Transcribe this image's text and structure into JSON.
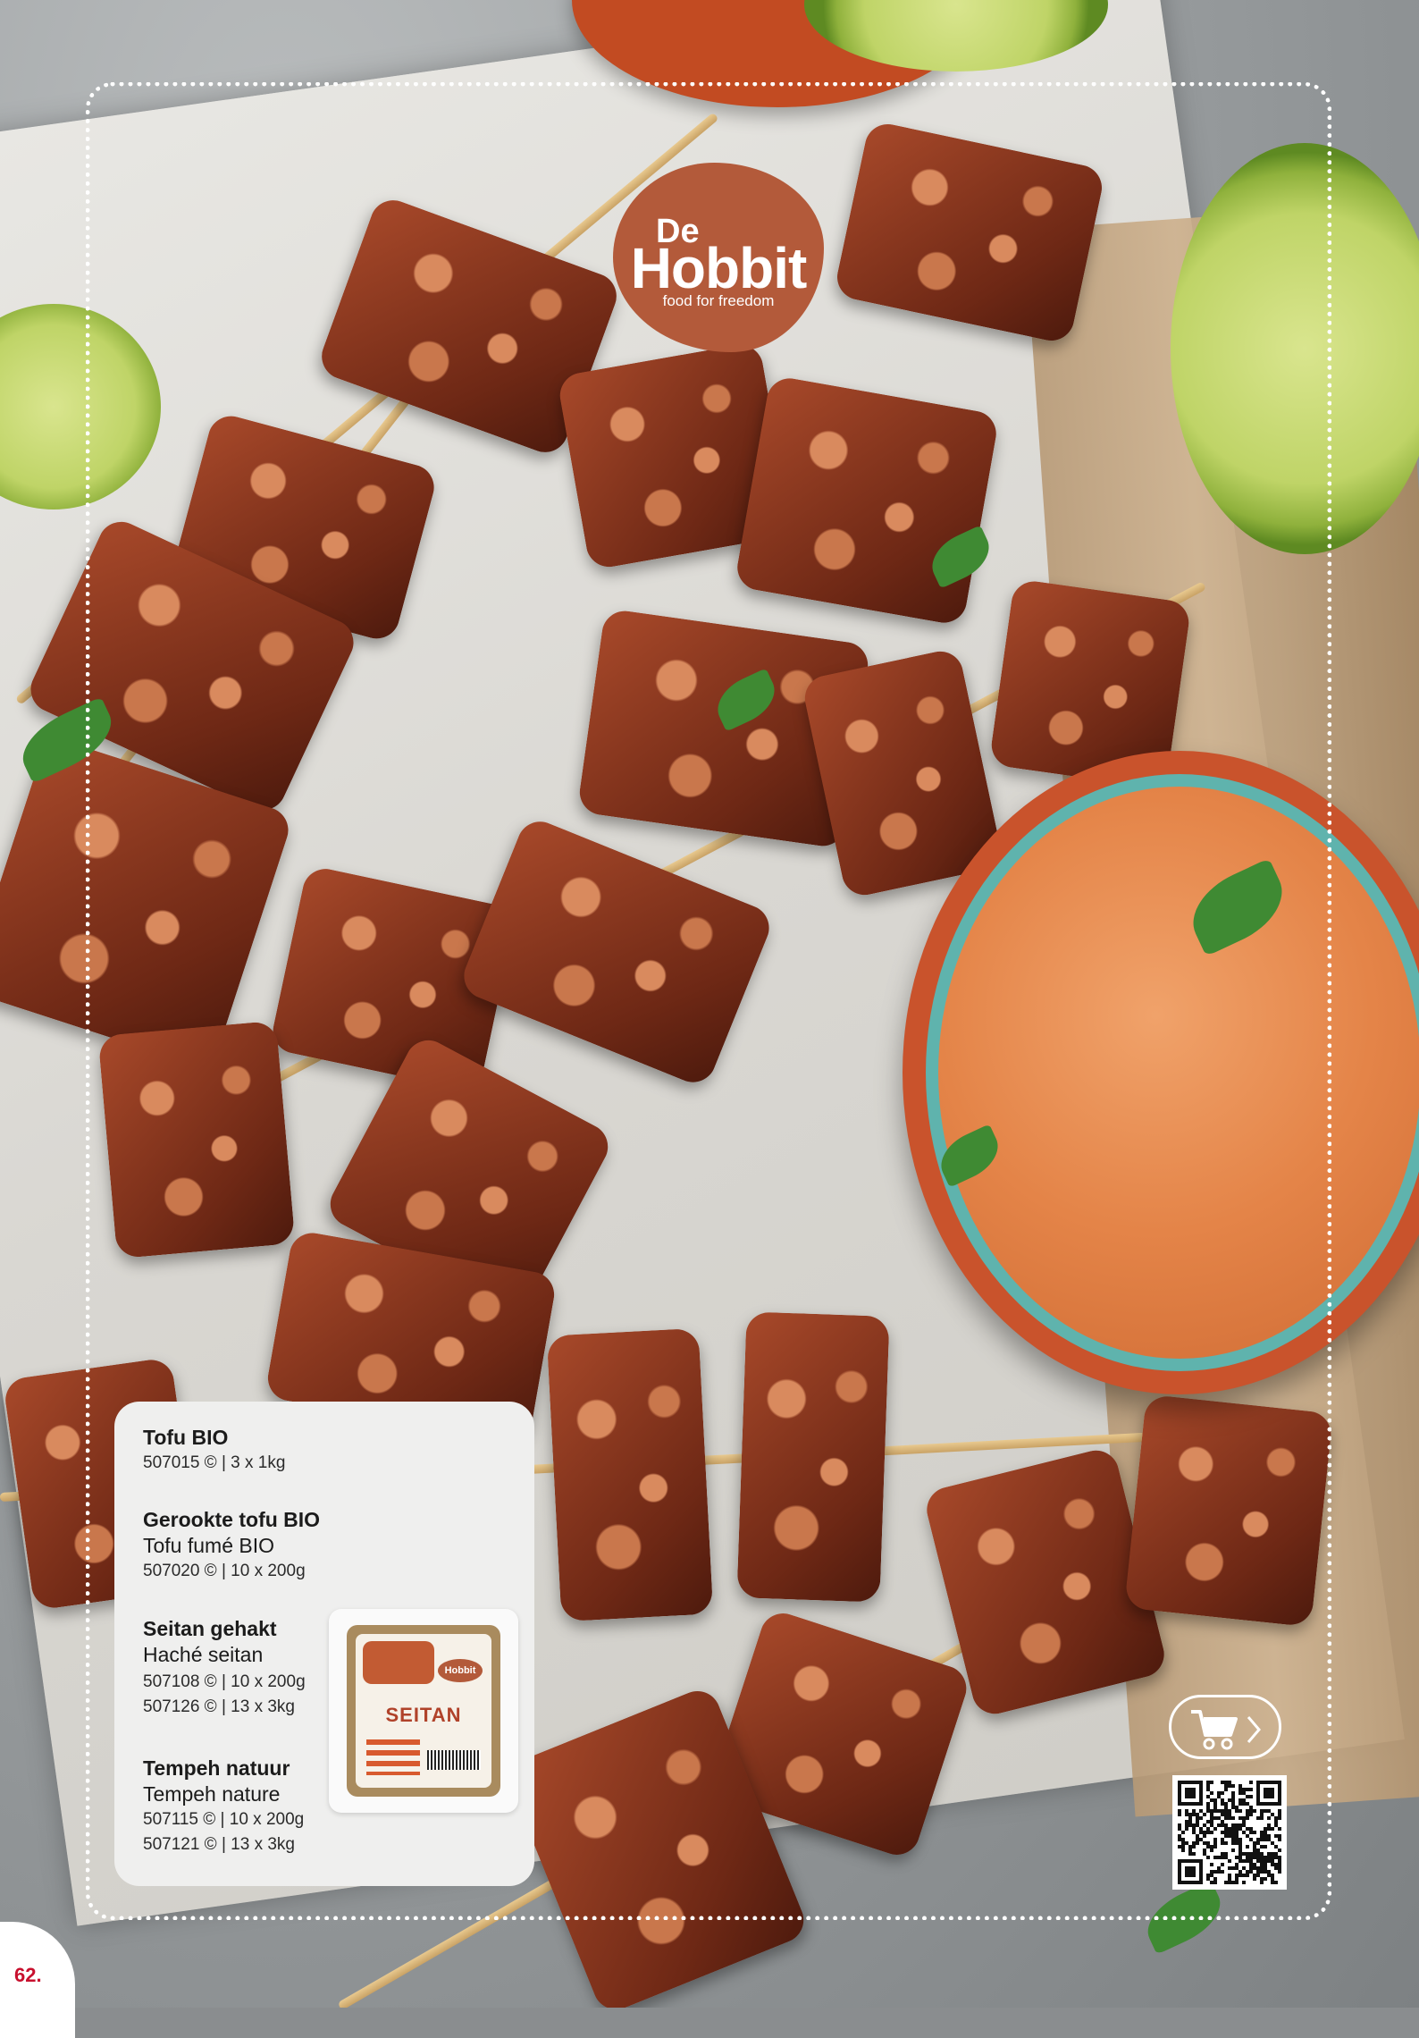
{
  "brand": {
    "logo_line1": "De",
    "logo_line2": "Hobbit",
    "logo_tagline": "food for freedom"
  },
  "products": [
    {
      "name": "Tofu BIO",
      "alt_name": "",
      "codes": [
        "507015 © | 3 x 1kg"
      ]
    },
    {
      "name": "Gerookte tofu BIO",
      "alt_name": "Tofu fumé BIO",
      "codes": [
        "507020 © | 10 x 200g"
      ]
    },
    {
      "name": "Seitan gehakt",
      "alt_name": "Haché seitan",
      "codes": [
        "507108 © | 10 x 200g",
        "507126 © | 13 x 3kg"
      ]
    },
    {
      "name": "Tempeh natuur",
      "alt_name": "Tempeh nature",
      "codes": [
        "507115 © | 10 x 200g",
        "507121 © | 13 x 3kg"
      ]
    }
  ],
  "package": {
    "brand": "Hobbit",
    "title": "SEITAN"
  },
  "icons": {
    "cart": "shopping-cart-icon",
    "chevron": "chevron-right-icon",
    "qr": "qr-code"
  },
  "page_number": "62.",
  "colors": {
    "brand": "#b35a3a",
    "page_number": "#c8102e",
    "card": "#efefee"
  }
}
